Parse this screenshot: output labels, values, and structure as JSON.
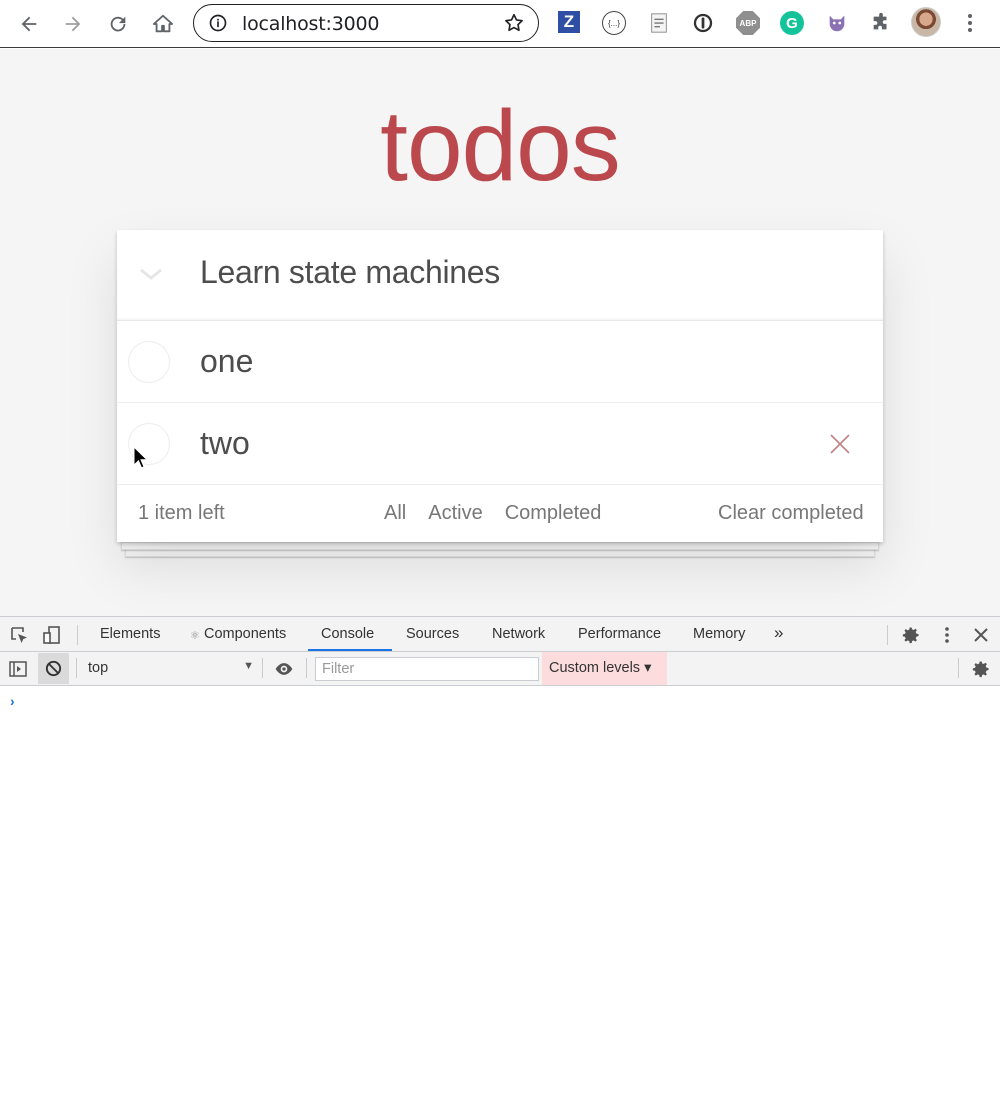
{
  "browser": {
    "url": "localhost:3000",
    "extensions": [
      {
        "name": "zotero-icon",
        "label": "Z"
      },
      {
        "name": "json-viewer-icon",
        "label": "{...}"
      },
      {
        "name": "page-capture-icon",
        "label": ""
      },
      {
        "name": "password-manager-icon",
        "label": ""
      },
      {
        "name": "adblock-plus-icon",
        "label": "ABP"
      },
      {
        "name": "grammarly-icon",
        "label": "G"
      },
      {
        "name": "octotree-icon",
        "label": ""
      },
      {
        "name": "extensions-puzzle-icon",
        "label": ""
      }
    ]
  },
  "app": {
    "title": "todos",
    "accent_color": "#b83f45",
    "new_todo_value": "Learn state machines",
    "todos": [
      {
        "label": "one",
        "completed": false
      },
      {
        "label": "two",
        "completed": false
      }
    ],
    "footer": {
      "count": "1 item left",
      "filters": [
        "All",
        "Active",
        "Completed"
      ],
      "clear_label": "Clear completed"
    }
  },
  "devtools": {
    "tabs": [
      "Elements",
      "Components",
      "Console",
      "Sources",
      "Network",
      "Performance",
      "Memory"
    ],
    "active_tab": "Console",
    "more_tabs": "»",
    "context": "top",
    "filter_placeholder": "Filter",
    "levels_label": "Custom levels ▾",
    "components_prefix": "⚛",
    "prompt": "›"
  }
}
